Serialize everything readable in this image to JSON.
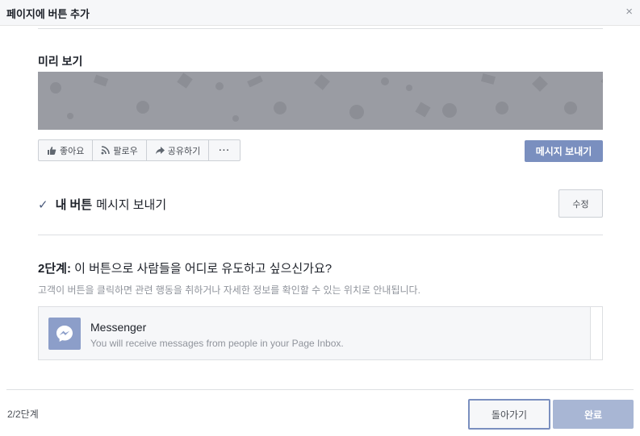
{
  "dialog": {
    "title": "페이지에 버튼 추가",
    "close_glyph": "×"
  },
  "preview": {
    "title": "미리 보기",
    "actions": [
      {
        "label": "좋아요",
        "icon": "thumbs-up-icon"
      },
      {
        "label": "팔로우",
        "icon": "rss-follow-icon"
      },
      {
        "label": "공유하기",
        "icon": "share-arrow-icon"
      },
      {
        "label": "···",
        "icon": "more-dots-icon"
      }
    ],
    "cta_label": "메시지 보내기"
  },
  "my_button": {
    "check_glyph": "✓",
    "prefix": "내 버튼",
    "value": "메시지 보내기",
    "edit_label": "수정"
  },
  "step2": {
    "step_label": "2단계:",
    "question": "이 버튼으로 사람들을 어디로 유도하고 싶으신가요?",
    "description": "고객이 버튼을 클릭하면 관련 행동을 취하거나 자세한 정보를 확인할 수 있는 위치로 안내됩니다.",
    "option": {
      "name": "Messenger",
      "description": "You will receive messages from people in your Page Inbox.",
      "icon": "messenger-icon"
    }
  },
  "footer": {
    "step_counter": "2/2단계",
    "back_label": "돌아가기",
    "done_label": "완료"
  },
  "colors": {
    "primary": "#7a8fbf",
    "primary_disabled": "#a8b6d4",
    "cover": "#9a9ca3",
    "border": "#dddfe2"
  }
}
